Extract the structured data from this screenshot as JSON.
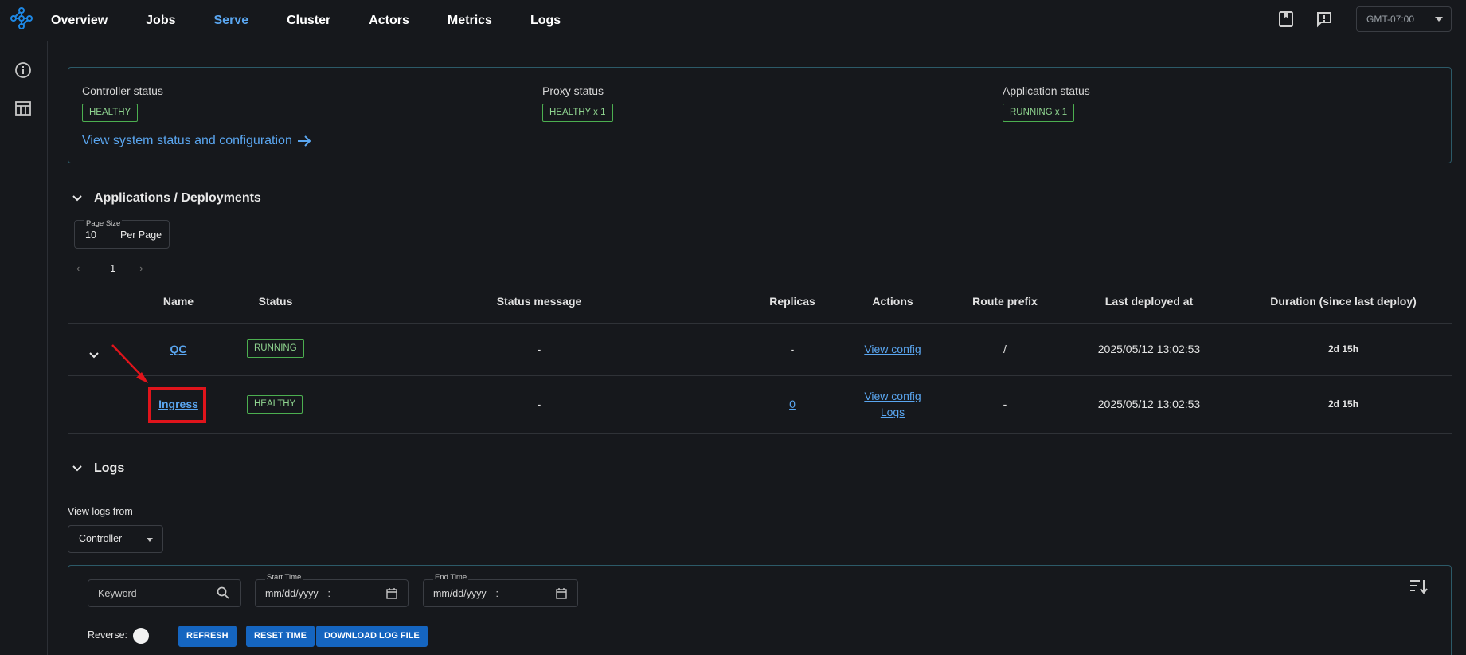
{
  "nav": {
    "items": [
      "Overview",
      "Jobs",
      "Serve",
      "Cluster",
      "Actors",
      "Metrics",
      "Logs"
    ],
    "active": "Serve",
    "timezone": "GMT-07:00"
  },
  "status": {
    "controller": {
      "label": "Controller status",
      "badge": "HEALTHY"
    },
    "proxy": {
      "label": "Proxy status",
      "badge": "HEALTHY  x 1"
    },
    "application": {
      "label": "Application status",
      "badge": "RUNNING  x 1"
    },
    "link": "View system status and configuration"
  },
  "apps": {
    "title": "Applications / Deployments",
    "page_size_label": "Page Size",
    "page_size_value": "10",
    "page_size_unit": "Per Page",
    "current_page": "1",
    "columns": [
      "Name",
      "Status",
      "Status message",
      "Replicas",
      "Actions",
      "Route prefix",
      "Last deployed at",
      "Duration (since last deploy)"
    ],
    "rows": [
      {
        "name": "QC",
        "status": "RUNNING",
        "message": "-",
        "replicas": "-",
        "action1": "View config",
        "action2": "",
        "route": "/",
        "deployed": "2025/05/12 13:02:53",
        "duration": "2d 15h"
      },
      {
        "name": "Ingress",
        "status": "HEALTHY",
        "message": "-",
        "replicas": "0",
        "action1": "View config",
        "action2": "Logs",
        "route": "-",
        "deployed": "2025/05/12 13:02:53",
        "duration": "2d 15h"
      }
    ]
  },
  "logs": {
    "title": "Logs",
    "view_from_label": "View logs from",
    "source": "Controller",
    "keyword_placeholder": "Keyword",
    "start_label": "Start Time",
    "start_value": "mm/dd/yyyy --:-- --",
    "end_label": "End Time",
    "end_value": "mm/dd/yyyy --:-- --",
    "reverse_label": "Reverse:",
    "buttons": {
      "refresh": "REFRESH",
      "reset": "RESET TIME",
      "download": "DOWNLOAD LOG FILE"
    }
  },
  "colors": {
    "accent": "#5aa6f0",
    "healthy": "#4caf50",
    "annotation": "#e0141b",
    "button": "#1565c0"
  }
}
